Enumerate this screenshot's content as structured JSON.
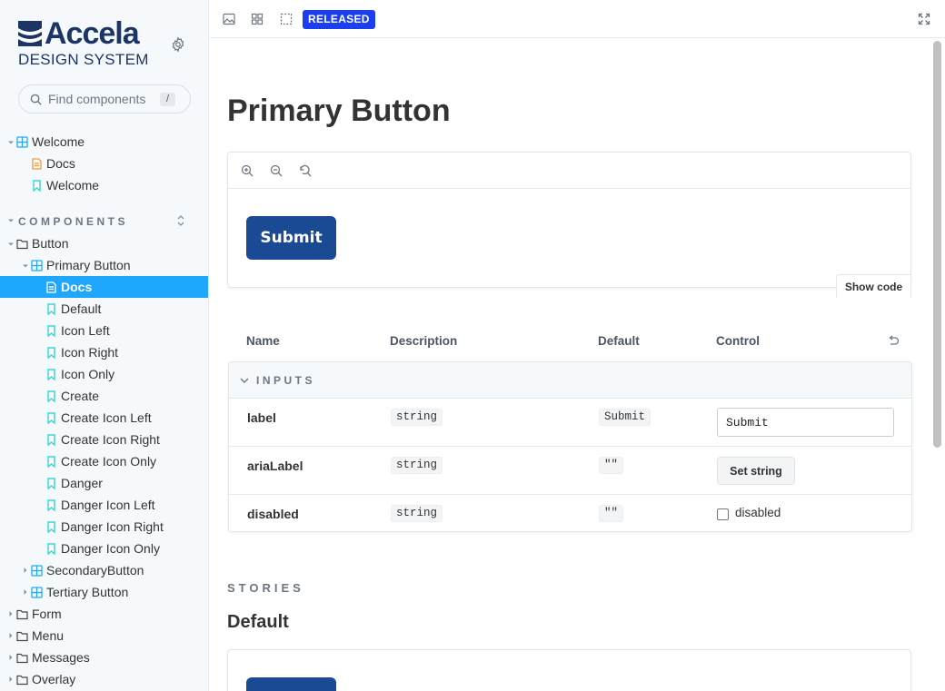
{
  "brand": {
    "name": "Accela",
    "subtitle": "DESIGN SYSTEM"
  },
  "search": {
    "placeholder": "Find components",
    "shortcut": "/"
  },
  "sidebar": {
    "welcome_group": {
      "label": "Welcome",
      "items": [
        {
          "label": "Docs",
          "icon": "document-icon"
        },
        {
          "label": "Welcome",
          "icon": "bookmark-icon"
        }
      ]
    },
    "section_title": "COMPONENTS",
    "button_folder": "Button",
    "primary_button": "Primary Button",
    "primary_items": [
      {
        "label": "Docs",
        "icon": "document-icon",
        "selected": true
      },
      {
        "label": "Default",
        "icon": "bookmark-icon"
      },
      {
        "label": "Icon Left",
        "icon": "bookmark-icon"
      },
      {
        "label": "Icon Right",
        "icon": "bookmark-icon"
      },
      {
        "label": "Icon Only",
        "icon": "bookmark-icon"
      },
      {
        "label": "Create",
        "icon": "bookmark-icon"
      },
      {
        "label": "Create Icon Left",
        "icon": "bookmark-icon"
      },
      {
        "label": "Create Icon Right",
        "icon": "bookmark-icon"
      },
      {
        "label": "Create Icon Only",
        "icon": "bookmark-icon"
      },
      {
        "label": "Danger",
        "icon": "bookmark-icon"
      },
      {
        "label": "Danger Icon Left",
        "icon": "bookmark-icon"
      },
      {
        "label": "Danger Icon Right",
        "icon": "bookmark-icon"
      },
      {
        "label": "Danger Icon Only",
        "icon": "bookmark-icon"
      }
    ],
    "other_components": [
      "SecondaryButton",
      "Tertiary Button"
    ],
    "other_folders": [
      "Form",
      "Menu",
      "Messages",
      "Overlay"
    ]
  },
  "toolbar": {
    "status_badge": "RELEASED"
  },
  "main": {
    "title": "Primary Button",
    "preview_button_label": "Submit",
    "show_code_label": "Show code",
    "table": {
      "headers": [
        "Name",
        "Description",
        "Default",
        "Control"
      ],
      "group_label": "INPUTS",
      "rows": [
        {
          "name": "label",
          "type": "string",
          "default": "Submit",
          "control_value": "Submit"
        },
        {
          "name": "ariaLabel",
          "type": "string",
          "default": "\"\"",
          "control_button": "Set string"
        },
        {
          "name": "disabled",
          "type": "string",
          "default": "\"\"",
          "checkbox_label": "disabled"
        }
      ]
    },
    "stories_label": "STORIES",
    "story_title": "Default"
  },
  "colors": {
    "accent": "#1ea7fd",
    "brand": "#1c3564",
    "primary_button": "#1a4a94",
    "badge": "#1a3ef0"
  }
}
